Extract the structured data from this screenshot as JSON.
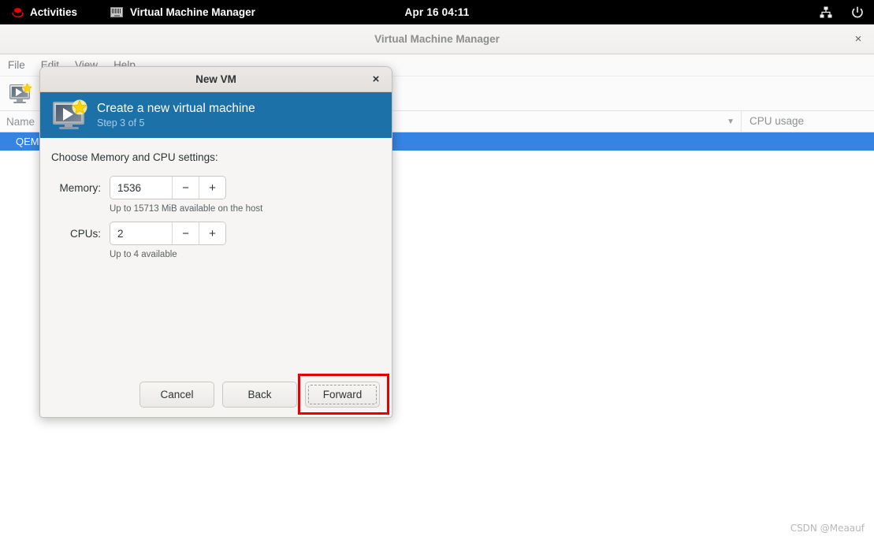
{
  "topbar": {
    "activities": "Activities",
    "app_name": "Virtual Machine Manager",
    "clock": "Apr 16  04:11",
    "icons": {
      "redhat": "redhat-logo-icon",
      "app": "virtual-machine-manager-icon",
      "network": "network-icon",
      "power": "power-icon"
    }
  },
  "main_window": {
    "title": "Virtual Machine Manager",
    "close_label": "×",
    "menu": [
      "File",
      "Edit",
      "View",
      "Help"
    ],
    "toolbar": {
      "new_vm_tooltip": "New VM"
    },
    "list": {
      "columns": [
        "Name",
        "CPU usage"
      ],
      "rows": [
        {
          "name": "QEMU",
          "cpu_usage": ""
        }
      ]
    },
    "watermark": "CSDN @Meaauf"
  },
  "dialog": {
    "title": "New VM",
    "close_label": "×",
    "banner": {
      "title": "Create a new virtual machine",
      "step": "Step 3 of 5",
      "icon": "new-vm-icon",
      "background_color": "#1c71a8"
    },
    "section_label": "Choose Memory and CPU settings:",
    "fields": [
      {
        "label": "Memory:",
        "value": "1536",
        "minus": "−",
        "plus": "+",
        "hint": "Up to 15713 MiB available on the host"
      },
      {
        "label": "CPUs:",
        "value": "2",
        "minus": "−",
        "plus": "+",
        "hint": "Up to 4 available"
      }
    ],
    "buttons": {
      "cancel": "Cancel",
      "back": "Back",
      "forward": "Forward"
    }
  },
  "annotation": {
    "highlight_color": "#e60000",
    "target": "forward-button"
  }
}
